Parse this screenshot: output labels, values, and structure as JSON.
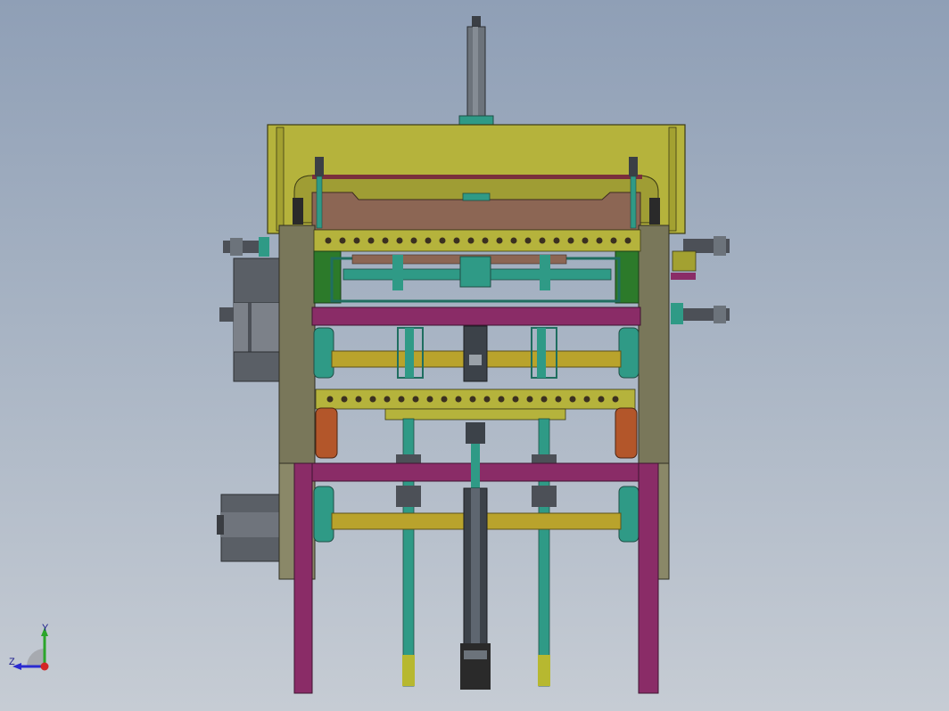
{
  "viewport": {
    "background_top": "#8f9fb6",
    "background_bottom": "#c6ccd4"
  },
  "colors": {
    "frame_olive": "#b5b33c",
    "frame_olive_dark": "#7d7a2a",
    "side_panel": "#79775a",
    "beam_magenta": "#8a2c67",
    "beam_magenta_light": "#a34a85",
    "teal": "#2f9a86",
    "teal_dark": "#1f6e60",
    "shaft_gold": "#b9a32c",
    "motor_gray": "#6f747c",
    "motor_gray_dark": "#4c5057",
    "rust": "#b3562a",
    "green_wheel": "#2c7a2a",
    "comb_brown": "#8c6654",
    "cylinder_gray": "#5e6670",
    "black_part": "#2a2a2a",
    "yellow_tip": "#b7b830"
  },
  "triad": {
    "x_label": "",
    "y_label": "Y",
    "z_label": "Z",
    "icon": "coordinate-triad-icon"
  }
}
